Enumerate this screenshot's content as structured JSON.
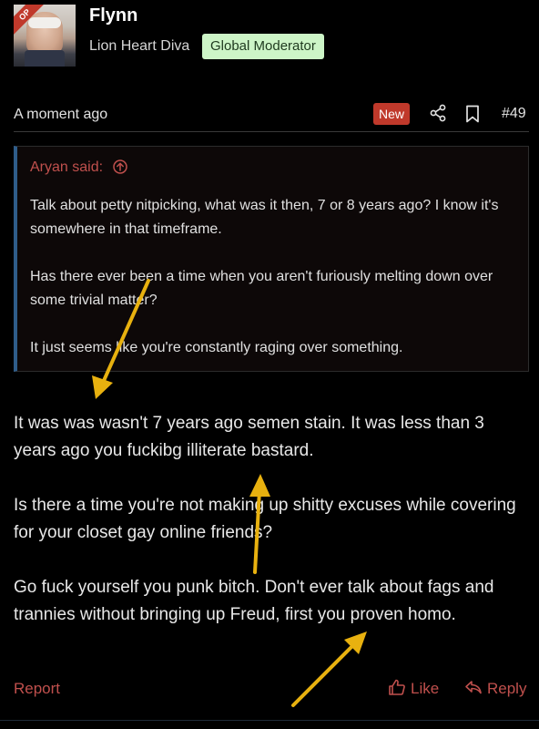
{
  "post": {
    "author": {
      "avatar_badge": "OP",
      "name": "Flynn",
      "title": "Lion Heart Diva",
      "role_badge": "Global Moderator"
    },
    "timestamp": "A moment ago",
    "new_label": "New",
    "number": "#49",
    "quote": {
      "header": "Aryan said:",
      "paragraphs": [
        "Talk about petty nitpicking, what was it then, 7 or 8 years ago? I know it's somewhere in that timeframe.",
        "Has there ever been a time when you aren't furiously melting down over some trivial matter?",
        "It just seems like you're constantly raging over something."
      ]
    },
    "body": [
      "It was was wasn't 7 years ago semen stain. It was less than 3 years ago you fuckibg illiterate bastard.",
      "Is there a time you're not making up shitty excuses while covering for your closet gay online friends?",
      "Go fuck yourself you punk bitch. Don't ever talk about fags and trannies without bringing up Freud, first you proven homo."
    ],
    "actions": {
      "report": "Report",
      "like": "Like",
      "reply": "Reply"
    }
  },
  "icons": {
    "share": "share-icon",
    "bookmark": "bookmark-icon",
    "quote_source": "arrow-up-circle-icon",
    "like": "thumbs-up-icon",
    "reply": "reply-icon"
  },
  "colors": {
    "background": "#000000",
    "accent_red": "#c0504d",
    "new_badge": "#c0392b",
    "moderator_badge_bg": "#cdf5c7",
    "quote_border": "#2f5d8a",
    "annotation_arrow": "#e8b10f"
  }
}
